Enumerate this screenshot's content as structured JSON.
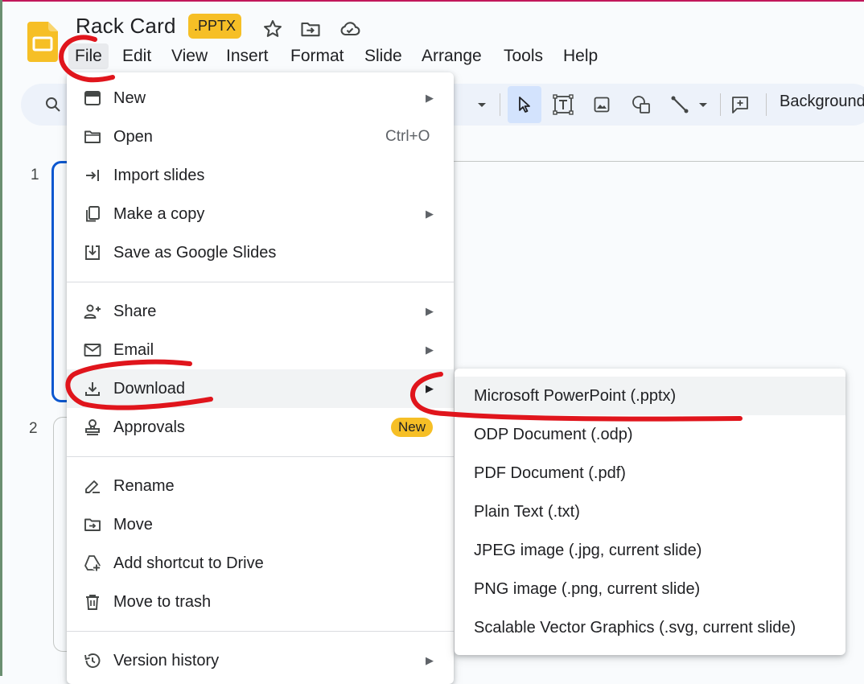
{
  "document": {
    "title": "Rack Card",
    "format_badge": ".PPTX",
    "title_icons": [
      "star-icon",
      "move-to-folder-icon",
      "cloud-saved-icon"
    ]
  },
  "menubar": {
    "items": [
      "File",
      "Edit",
      "View",
      "Insert",
      "Format",
      "Slide",
      "Arrange",
      "Tools",
      "Help"
    ],
    "active": "File"
  },
  "toolbar": {
    "background_label": "Background",
    "tools": [
      "search-icon",
      "dropdown-arrow-icon",
      "select-cursor-icon",
      "text-box-icon",
      "image-icon",
      "shapes-icon",
      "line-icon",
      "line-dropdown-icon",
      "add-comment-icon"
    ]
  },
  "filmstrip": {
    "slide_numbers": [
      "1",
      "2"
    ]
  },
  "file_menu": {
    "items": [
      {
        "label": "New",
        "icon": "new-presentation-icon",
        "submenu": true
      },
      {
        "label": "Open",
        "icon": "folder-icon",
        "shortcut": "Ctrl+O"
      },
      {
        "label": "Import slides",
        "icon": "import-icon"
      },
      {
        "label": "Make a copy",
        "icon": "copy-icon",
        "submenu": true
      },
      {
        "label": "Save as Google Slides",
        "icon": "save-icon"
      },
      {
        "label": "Share",
        "icon": "share-person-icon",
        "submenu": true
      },
      {
        "label": "Email",
        "icon": "email-icon",
        "submenu": true
      },
      {
        "label": "Download",
        "icon": "download-icon",
        "submenu": true,
        "highlighted": true
      },
      {
        "label": "Approvals",
        "icon": "approvals-stamp-icon",
        "badge": "New"
      },
      {
        "label": "Rename",
        "icon": "rename-icon"
      },
      {
        "label": "Move",
        "icon": "move-folder-icon"
      },
      {
        "label": "Add shortcut to Drive",
        "icon": "add-shortcut-drive-icon"
      },
      {
        "label": "Move to trash",
        "icon": "trash-icon"
      },
      {
        "label": "Version history",
        "icon": "history-icon",
        "submenu": true
      }
    ]
  },
  "download_submenu": {
    "items": [
      "Microsoft PowerPoint (.pptx)",
      "ODP Document (.odp)",
      "PDF Document (.pdf)",
      "Plain Text (.txt)",
      "JPEG image (.jpg, current slide)",
      "PNG image (.png, current slide)",
      "Scalable Vector Graphics (.svg, current slide)"
    ],
    "highlighted": "Microsoft PowerPoint (.pptx)"
  },
  "colors": {
    "accent_blue": "#0b57d0",
    "badge_yellow": "#f6bf26",
    "annotation_red": "#e0151c",
    "menu_highlight": "#f1f3f4"
  }
}
